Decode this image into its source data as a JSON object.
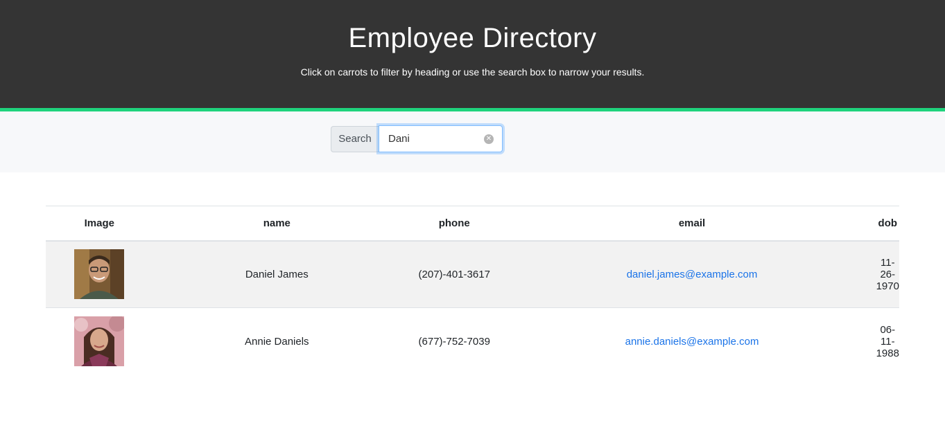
{
  "header": {
    "title": "Employee Directory",
    "subtitle": "Click on carrots to filter by heading or use the search box to narrow your results."
  },
  "search": {
    "label": "Search",
    "value": "Dani"
  },
  "colors": {
    "header_bg": "#343434",
    "accent": "#1fd37c",
    "link": "#1a73e8",
    "alt_row": "#f2f2f2"
  },
  "table": {
    "columns": [
      "Image",
      "name",
      "phone",
      "email",
      "dob"
    ],
    "rows": [
      {
        "name": "Daniel James",
        "phone": "(207)-401-3617",
        "email": "daniel.james@example.com",
        "dob": "11-26-1970"
      },
      {
        "name": "Annie Daniels",
        "phone": "(677)-752-7039",
        "email": "annie.daniels@example.com",
        "dob": "06-11-1988"
      }
    ]
  }
}
